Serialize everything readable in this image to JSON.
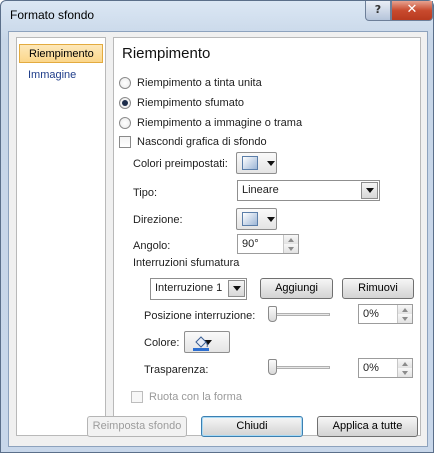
{
  "window": {
    "title": "Formato sfondo",
    "help_glyph": "?",
    "close_glyph": "✕"
  },
  "nav": {
    "items": [
      {
        "label": "Riempimento",
        "selected": true
      },
      {
        "label": "Immagine",
        "selected": false
      }
    ]
  },
  "panel": {
    "heading": "Riempimento",
    "fill_options": [
      {
        "label": "Riempimento a tinta unita",
        "checked": false
      },
      {
        "label": "Riempimento sfumato",
        "checked": true
      },
      {
        "label": "Riempimento a immagine o trama",
        "checked": false
      }
    ],
    "hide_graphics": {
      "label": "Nascondi grafica di sfondo",
      "checked": false
    },
    "preset_colors_label": "Colori preimpostati:",
    "type_label": "Tipo:",
    "type_value": "Lineare",
    "direction_label": "Direzione:",
    "angle_label": "Angolo:",
    "angle_value": "90°",
    "gradient_stops_label": "Interruzioni sfumatura",
    "stop_select_value": "Interruzione 1",
    "add_button": "Aggiungi",
    "remove_button": "Rimuovi",
    "stop_position_label": "Posizione interruzione:",
    "stop_position_value": "0%",
    "color_label": "Colore:",
    "transparency_label": "Trasparenza:",
    "transparency_value": "0%",
    "rotate_with_shape": {
      "label": "Ruota con la forma",
      "checked": false,
      "disabled": true
    }
  },
  "footer": {
    "reset_button": "Reimposta sfondo",
    "close_button": "Chiudi",
    "apply_all_button": "Applica a tutte"
  },
  "colors": {
    "selected_nav_bg": "#fbd68a",
    "frame": "#c8d7ea",
    "close_red": "#c84a2e"
  }
}
